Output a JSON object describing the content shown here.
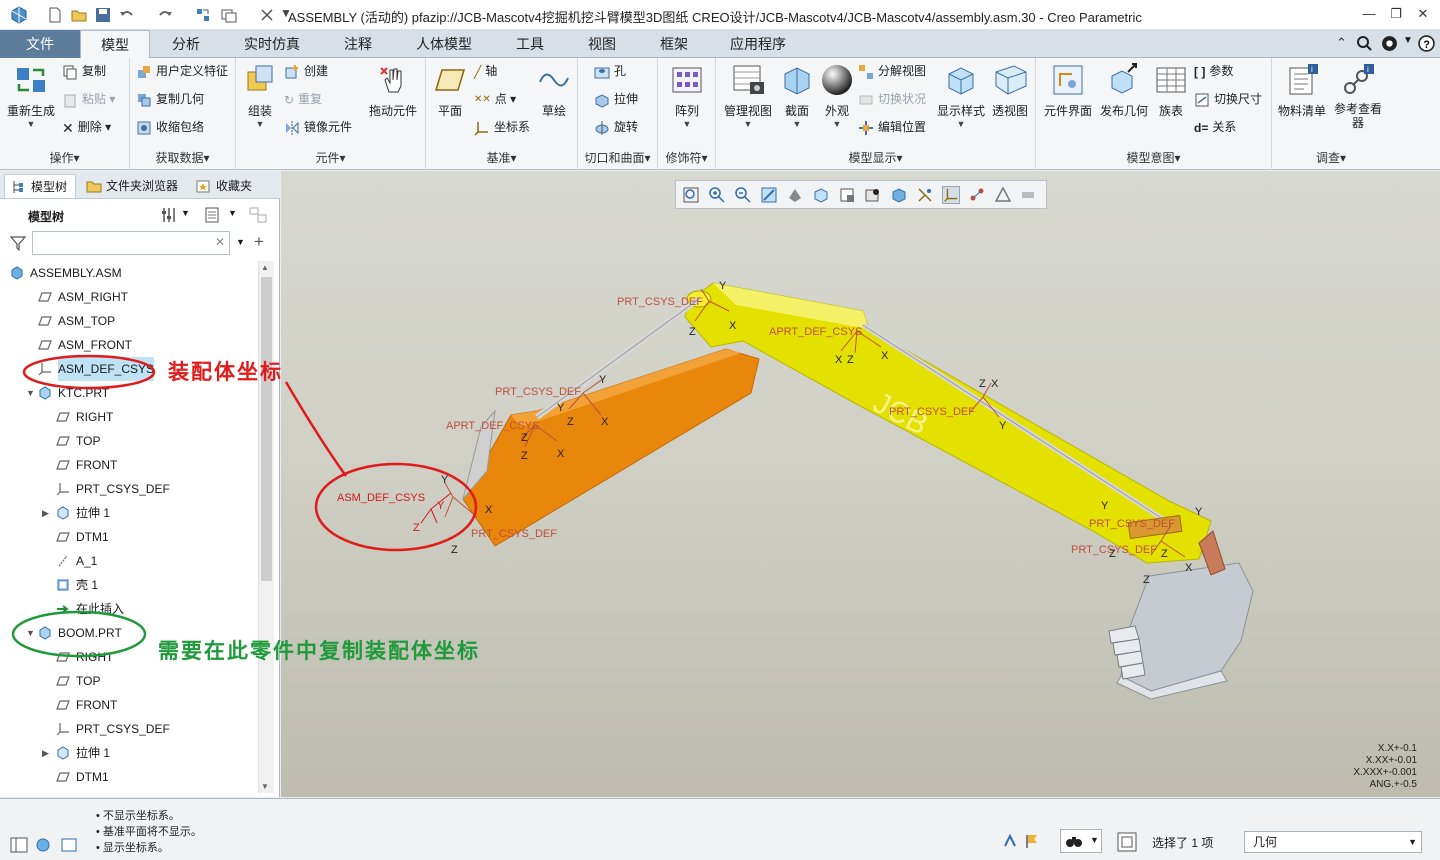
{
  "window": {
    "title": "ASSEMBLY (活动的) pfazip://JCB-Mascotv4挖掘机挖斗臂模型3D图纸 CREO设计/JCB-Mascotv4/JCB-Mascotv4/assembly.asm.30 - Creo Parametric",
    "minimize": "—",
    "restore": "❐",
    "close": "✕"
  },
  "ribbon": {
    "tabs": [
      "文件",
      "模型",
      "分析",
      "实时仿真",
      "注释",
      "人体模型",
      "工具",
      "视图",
      "框架",
      "应用程序"
    ],
    "active_tab": "模型",
    "groups": {
      "operations": {
        "label": "操作▾",
        "regenerate": "重新生成",
        "copy": "复制",
        "paste": "粘贴",
        "delete": "删除"
      },
      "get_data": {
        "label": "获取数据▾",
        "user_feature": "用户定义特征",
        "copy_geom": "复制几何",
        "shrinkwrap": "收缩包络"
      },
      "component": {
        "label": "元件▾",
        "assemble": "组装",
        "create": "创建",
        "repeat": "重复",
        "mirror": "镜像元件",
        "drag": "拖动元件"
      },
      "datum": {
        "label": "基准▾",
        "plane": "平面",
        "axis": "轴",
        "point": "点",
        "csys": "坐标系",
        "sketch": "草绘"
      },
      "cut_surface": {
        "label": "切口和曲面▾",
        "hole": "孔",
        "extrude": "拉伸",
        "revolve": "旋转"
      },
      "modifiers": {
        "label": "修饰符▾",
        "pattern": "阵列"
      },
      "model_display": {
        "label": "模型显示▾",
        "manage_views": "管理视图",
        "section": "截面",
        "appearance": "外观",
        "explode": "分解视图",
        "toggle_status": "切换状况",
        "edit_position": "编辑位置",
        "display_style": "显示样式",
        "perspective": "透视图"
      },
      "model_intent": {
        "label": "模型意图▾",
        "comp_interface": "元件界面",
        "publish_geom": "发布几何",
        "family_table": "族表",
        "parameters": "参数",
        "switch_dims": "切换尺寸",
        "relations": "关系"
      },
      "investigate": {
        "label": "调查▾",
        "bom": "物料清单",
        "ref_viewer": "参考查看器"
      }
    }
  },
  "left_pane": {
    "tabs": [
      "模型树",
      "文件夹浏览器",
      "收藏夹"
    ],
    "tree_title": "模型树",
    "filter_placeholder": "",
    "tree": [
      {
        "label": "ASSEMBLY.ASM",
        "icon": "assembly-icon",
        "level": 0
      },
      {
        "label": "ASM_RIGHT",
        "icon": "datum-plane-icon",
        "level": 1
      },
      {
        "label": "ASM_TOP",
        "icon": "datum-plane-icon",
        "level": 1
      },
      {
        "label": "ASM_FRONT",
        "icon": "datum-plane-icon",
        "level": 1
      },
      {
        "label": "ASM_DEF_CSYS",
        "icon": "csys-icon",
        "level": 1,
        "selected": true
      },
      {
        "label": "KTC.PRT",
        "icon": "part-icon",
        "level": 1,
        "expander": "▼"
      },
      {
        "label": "RIGHT",
        "icon": "datum-plane-icon",
        "level": 2
      },
      {
        "label": "TOP",
        "icon": "datum-plane-icon",
        "level": 2
      },
      {
        "label": "FRONT",
        "icon": "datum-plane-icon",
        "level": 2
      },
      {
        "label": "PRT_CSYS_DEF",
        "icon": "csys-icon",
        "level": 2
      },
      {
        "label": "拉伸 1",
        "icon": "extrude-icon",
        "level": 2,
        "expander": "▶"
      },
      {
        "label": "DTM1",
        "icon": "datum-plane-icon",
        "level": 2
      },
      {
        "label": "A_1",
        "icon": "axis-icon",
        "level": 2
      },
      {
        "label": "壳 1",
        "icon": "shell-icon",
        "level": 2
      },
      {
        "label": "在此插入",
        "icon": "insert-here-icon",
        "level": 2
      },
      {
        "label": "BOOM.PRT",
        "icon": "part-icon",
        "level": 1,
        "expander": "▼"
      },
      {
        "label": "RIGHT",
        "icon": "datum-plane-icon",
        "level": 2
      },
      {
        "label": "TOP",
        "icon": "datum-plane-icon",
        "level": 2
      },
      {
        "label": "FRONT",
        "icon": "datum-plane-icon",
        "level": 2
      },
      {
        "label": "PRT_CSYS_DEF",
        "icon": "csys-icon",
        "level": 2
      },
      {
        "label": "拉伸 1",
        "icon": "extrude-icon",
        "level": 2,
        "expander": "▶"
      },
      {
        "label": "DTM1",
        "icon": "datum-plane-icon",
        "level": 2
      }
    ]
  },
  "annotations": {
    "red": "装配体坐标",
    "green": "需要在此零件中复制装配体坐标",
    "red_color": "#e01b1b",
    "green_color": "#1f9a3a"
  },
  "viewport": {
    "labels": {
      "csys_asm": "ASM_DEF_CSYS",
      "csys_prt": "PRT_CSYS_DEF",
      "csys_overlap": "APRT_DEF_CSYS",
      "x": "X",
      "y": "Y",
      "z": "Z",
      "logo": "JCB"
    },
    "coords": [
      "X.X+-0.1",
      "X.XX+-0.01",
      "X.XXX+-0.001",
      "ANG.+-0.5"
    ],
    "colors": {
      "boom": "#e6e000",
      "dipper": "#e8860b",
      "bucket": "#c8ccd2",
      "csys": "#c0503a"
    }
  },
  "status": {
    "messages": [
      "• 不显示坐标系。",
      "• 基准平面将不显示。",
      "• 显示坐标系。"
    ],
    "selected": "选择了 1 项",
    "filter_value": "几何"
  }
}
